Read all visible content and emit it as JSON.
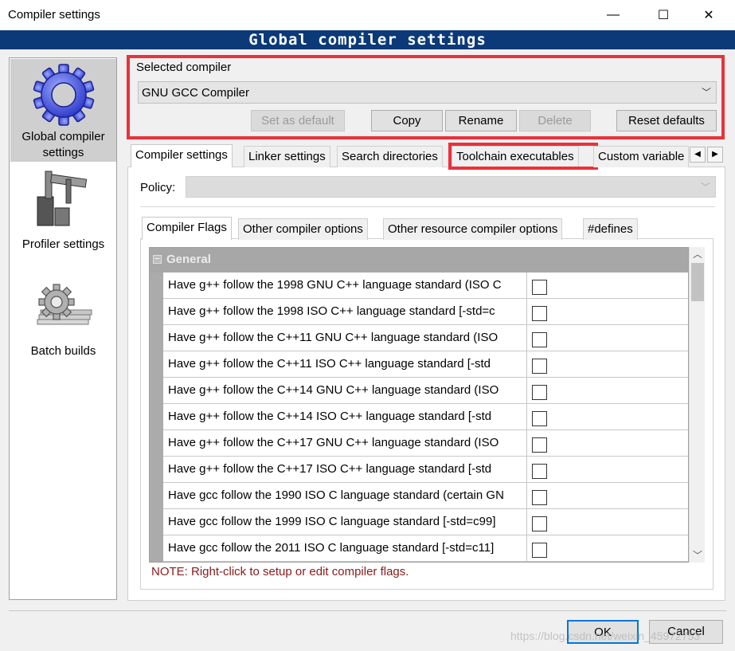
{
  "window": {
    "title": "Compiler settings",
    "controls": {
      "minimize": "—",
      "maximize": "☐",
      "close": "✕"
    }
  },
  "banner": "Global compiler settings",
  "sidebar": {
    "items": [
      {
        "label": "Global compiler settings",
        "icon": "gear-icon",
        "selected": true
      },
      {
        "label": "Profiler settings",
        "icon": "caliper-icon"
      },
      {
        "label": "Batch builds",
        "icon": "batch-gear-icon"
      }
    ]
  },
  "selected_compiler": {
    "legend": "Selected compiler",
    "value": "GNU GCC Compiler",
    "buttons": {
      "set_default": "Set as default",
      "copy": "Copy",
      "rename": "Rename",
      "delete": "Delete",
      "reset": "Reset defaults"
    }
  },
  "tabs": [
    "Compiler settings",
    "Linker settings",
    "Search directories",
    "Toolchain executables",
    "Custom variable"
  ],
  "tab_arrows": {
    "left": "◀",
    "right": "▶"
  },
  "policy": {
    "label": "Policy:",
    "value": ""
  },
  "sub_tabs": [
    "Compiler Flags",
    "Other compiler options",
    "Other resource compiler options",
    "#defines"
  ],
  "flags": {
    "category": "General",
    "category_toggle": "−",
    "rows": [
      "Have g++ follow the 1998 GNU C++ language standard (ISO C",
      "Have g++ follow the 1998 ISO C++ language standard  [-std=c",
      "Have g++ follow the C++11 GNU C++ language standard (ISO",
      "Have g++ follow the C++11 ISO C++ language standard  [-std",
      "Have g++ follow the C++14 GNU C++ language standard (ISO",
      "Have g++ follow the C++14 ISO C++ language standard  [-std",
      "Have g++ follow the C++17 GNU C++ language standard (ISO",
      "Have g++ follow the C++17 ISO C++ language standard  [-std",
      "Have gcc follow the 1990 ISO C language standard  (certain GN",
      "Have gcc follow the 1999 ISO C language standard  [-std=c99]",
      "Have gcc follow the 2011 ISO C language standard  [-std=c11]"
    ]
  },
  "scroll": {
    "up": "︿",
    "down": "﹀"
  },
  "note": "NOTE: Right-click to setup or edit compiler flags.",
  "dialog_buttons": {
    "ok": "OK",
    "cancel": "Cancel"
  },
  "watermark": "https://blog.csdn.net/weixin_45972753"
}
